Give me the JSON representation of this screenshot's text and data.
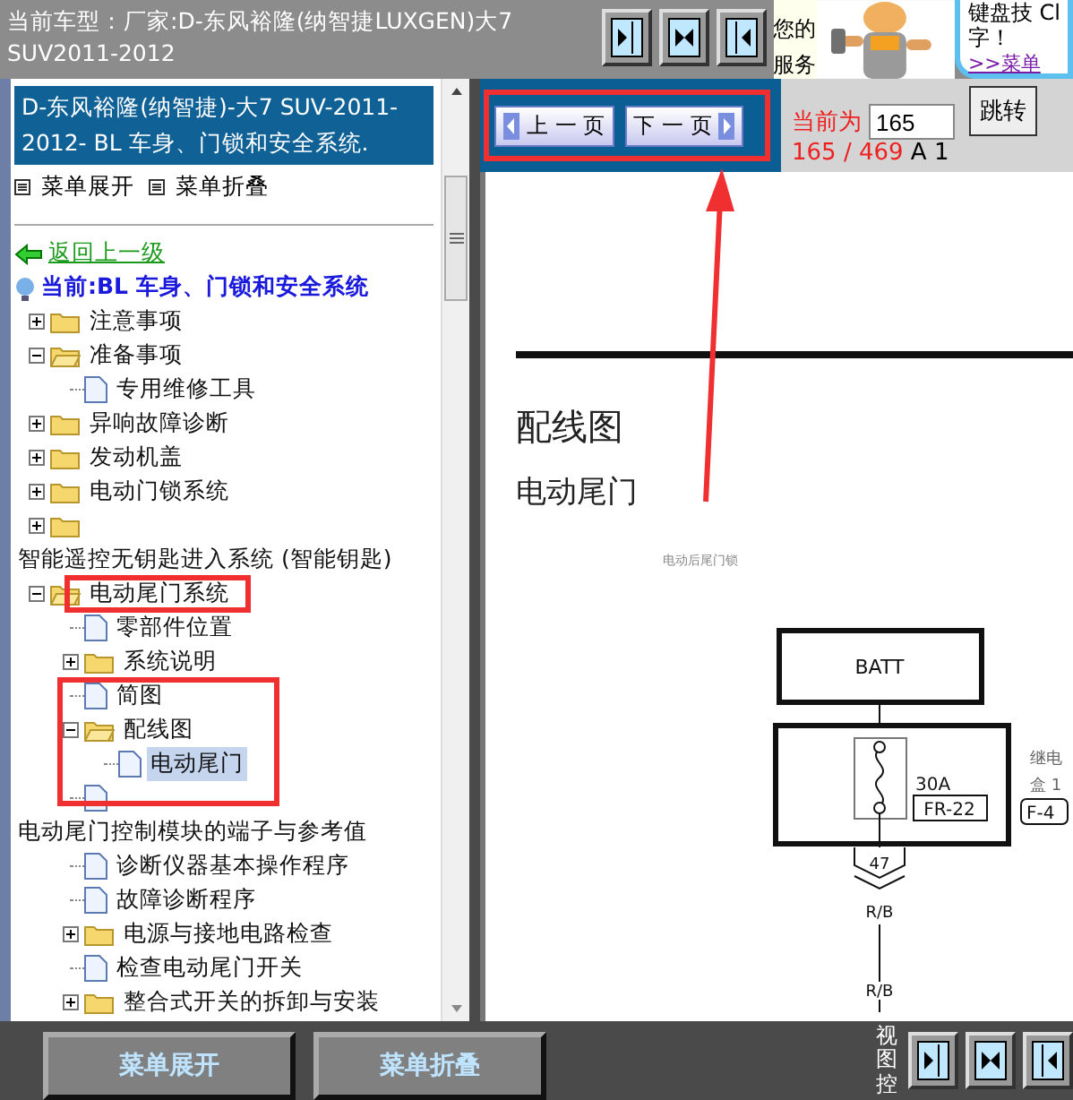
{
  "header": {
    "title": "当前车型：厂家:D-东风裕隆(纳智捷LUXGEN)大7 SUV2011-2012",
    "notice": [
      "您的",
      "服务"
    ],
    "bubble": [
      "键盘技  Cl",
      "字！"
    ],
    "bubble_link": ">>菜单"
  },
  "sidebar": {
    "title": "D-东风裕隆(纳智捷)-大7 SUV-2011-2012- BL 车身、门锁和安全系统.",
    "menu_links": [
      "菜单展开",
      "菜单折叠"
    ],
    "back_link": "返回上一级",
    "current": "当前:BL 车身、门锁和安全系统",
    "tree": [
      {
        "label": "注意事项",
        "kind": "folder",
        "expanded": false,
        "selected": false
      },
      {
        "label": "准备事项",
        "kind": "folder",
        "expanded": true,
        "selected": false,
        "children": [
          {
            "label": "专用维修工具",
            "kind": "doc",
            "selected": false
          }
        ]
      },
      {
        "label": "异响故障诊断",
        "kind": "folder",
        "expanded": false,
        "selected": false
      },
      {
        "label": "发动机盖",
        "kind": "folder",
        "expanded": false,
        "selected": false
      },
      {
        "label": "电动门锁系统",
        "kind": "folder",
        "expanded": false,
        "selected": false
      },
      {
        "label": "智能遥控无钥匙进入系统 (智能钥匙)",
        "kind": "folder",
        "expanded": false,
        "selected": false,
        "wrapped": true
      },
      {
        "label": "电动尾门系统",
        "kind": "folder",
        "expanded": true,
        "selected": false,
        "children": [
          {
            "label": "零部件位置",
            "kind": "doc",
            "selected": false
          },
          {
            "label": "系统说明",
            "kind": "folder",
            "expanded": false,
            "selected": false
          },
          {
            "label": "简图",
            "kind": "doc",
            "selected": false
          },
          {
            "label": "配线图",
            "kind": "folder",
            "expanded": true,
            "selected": false,
            "children": [
              {
                "label": "电动尾门",
                "kind": "doc",
                "selected": true
              }
            ]
          },
          {
            "label": "电动尾门控制模块的端子与参考值",
            "kind": "doc",
            "selected": false,
            "wrapped": true
          },
          {
            "label": "诊断仪器基本操作程序",
            "kind": "doc",
            "selected": false
          },
          {
            "label": "故障诊断程序",
            "kind": "doc",
            "selected": false
          },
          {
            "label": "电源与接地电路检查",
            "kind": "folder",
            "expanded": false,
            "selected": false
          },
          {
            "label": "检查电动尾门开关",
            "kind": "doc",
            "selected": false
          },
          {
            "label": "整合式开关的拆卸与安装",
            "kind": "folder",
            "expanded": false,
            "selected": false
          }
        ]
      }
    ]
  },
  "pager": {
    "prev": "上 一 页",
    "next": "下 一 页",
    "current_label": "当前为",
    "page": "165",
    "go": "跳转",
    "position": "165 / 469",
    "suffix": "A 1"
  },
  "document": {
    "heading": "配线图",
    "subheading": "电动尾门",
    "caption": "电动后尾门锁",
    "battery": "BATT",
    "fuse_rating": "30A",
    "fuse_code": "FR-22",
    "connector": "47",
    "wire_top": "R/B",
    "wire_bottom": "R/B",
    "relay_box": [
      "继电",
      "盒 1"
    ],
    "relay_code": "F-4"
  },
  "footer": {
    "buttons": [
      "菜单展开",
      "菜单折叠"
    ],
    "view_label": "视图控"
  }
}
